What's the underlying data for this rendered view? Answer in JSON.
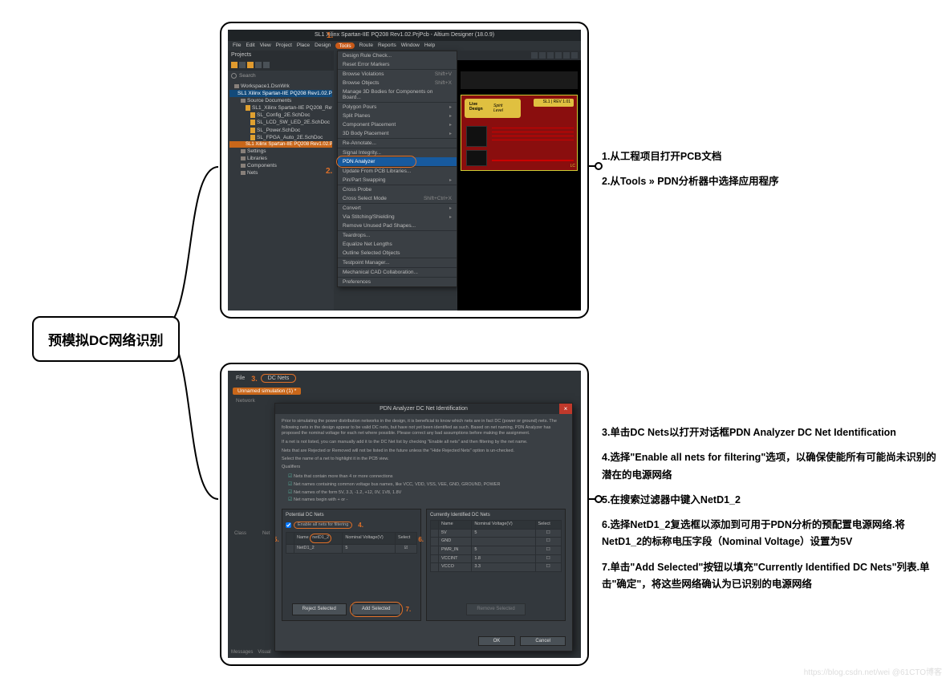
{
  "title_box": "预模拟DC网络识别",
  "top_annotations": [
    "1.从工程项目打开PCB文档",
    "2.从Tools » PDN分析器中选择应用程序"
  ],
  "bottom_annotations": [
    "3.单击DC Nets以打开对话框PDN Analyzer DC Net Identification",
    "4.选择\"Enable all nets for filtering\"选项，以确保使能所有可能尚未识别的潜在的电源网络",
    "5.在搜索过滤器中键入NetD1_2",
    "6.选择NetD1_2复选框以添加到可用于PDN分析的预配置电源网络.将NetD1_2的标称电压字段（Nominal Voltage）设置为5V",
    "7.单击\"Add Selected\"按钮以填充\"Currently Identified DC Nets\"列表.单击\"确定\"，将这些网络确认为已识别的电源网络"
  ],
  "altium": {
    "app_title": "SL1 Xilinx Spartan-IIE PQ208 Rev1.02.PrjPcb - Altium Designer (18.0.9)",
    "menus": [
      "File",
      "Edit",
      "View",
      "Project",
      "Place",
      "Design",
      "Tools",
      "Route",
      "Reports",
      "Window",
      "Help"
    ],
    "projects_label": "Projects",
    "search_label": "Search",
    "tree": {
      "workspace": "Workspace1.DsnWrk",
      "project": "SL1 Xilinx Spartan-IIE PQ208 Rev1.02.PrjPcb",
      "source_docs": "Source Documents",
      "files": [
        "SL1_Xilinx Spartan-IIE PQ208_Rev1.02.S",
        "SL_Config_2E.SchDoc",
        "SL_LCD_SW_LED_2E.SchDoc",
        "SL_Power.SchDoc",
        "SL_FPGA_Auto_2E.SchDoc"
      ],
      "active_file": "SL1 Xilinx Spartan-IIE PQ208 Rev1.02.P",
      "folders": [
        "Settings",
        "Libraries",
        "Components",
        "Nets"
      ]
    },
    "tools_menu": [
      {
        "label": "Design Rule Check...",
        "sep": false
      },
      {
        "label": "Reset Error Markers",
        "sep": true
      },
      {
        "label": "Browse Violations",
        "shortcut": "Shift+V"
      },
      {
        "label": "Browse Objects",
        "shortcut": "Shift+X"
      },
      {
        "label": "Manage 3D Bodies for Components on Board...",
        "sep": true
      },
      {
        "label": "Polygon Pours",
        "sub": true
      },
      {
        "label": "Split Planes",
        "sub": true
      },
      {
        "label": "Component Placement",
        "sub": true
      },
      {
        "label": "3D Body Placement",
        "sub": true,
        "sep": true
      },
      {
        "label": "Re-Annotate...",
        "sep": true
      },
      {
        "label": "Signal Integrity...",
        "sep": false
      },
      {
        "label": "PDN Analyzer",
        "hl": true,
        "sep": true
      },
      {
        "label": "Update From PCB Libraries...",
        "sep": false
      },
      {
        "label": "Pin/Part Swapping",
        "sub": true,
        "sep": true
      },
      {
        "label": "Cross Probe",
        "sep": false
      },
      {
        "label": "Cross Select Mode",
        "shortcut": "Shift+Ctrl+X",
        "sep": true
      },
      {
        "label": "Convert",
        "sub": true
      },
      {
        "label": "Via Stitching/Shielding",
        "sub": true
      },
      {
        "label": "Remove Unused Pad Shapes...",
        "sep": true
      },
      {
        "label": "Teardrops...",
        "sep": false
      },
      {
        "label": "Equalize Net Lengths",
        "sep": false
      },
      {
        "label": "Outline Selected Objects",
        "sep": true
      },
      {
        "label": "Testpoint Manager...",
        "sep": true
      },
      {
        "label": "Mechanical CAD Collaboration...",
        "sep": true
      },
      {
        "label": "Preferences",
        "sep": false
      }
    ],
    "step_labels": {
      "s1": "1.",
      "s2": "2."
    }
  },
  "pdn": {
    "tabs": {
      "file": "File",
      "num3": "3.",
      "dcnets": "DC Nets"
    },
    "sim_tab": "Unnamed simulation (1) *",
    "network_label": "Network",
    "cols": {
      "class": "Class",
      "net": "Net"
    },
    "bottom_tabs": [
      "Messages",
      "Visual"
    ],
    "dialog": {
      "title": "PDN Analyzer DC Net Identification",
      "intro1": "Prior to simulating the power distribution networks in the design, it is beneficial to know which nets are in fact DC (power or ground) nets. The following nets in the design appear to be valid DC nets, but have not yet been identified as such. Based on net naming, PDN Analyzer has proposed the nominal voltage for each net where possible. Please correct any bad assumptions before making the assignment.",
      "intro2": "If a net is not listed, you can manually add it to the DC Net list by checking \"Enable all nets\" and then filtering by the net name.",
      "intro3": "Nets that are Rejected or Removed will not be listed in the future unless the \"Hide Rejected Nets\" option is un-checked.",
      "select_hint": "Select the name of a net to highlight it in the PCB view.",
      "qualifiers_label": "Qualifiers",
      "qualifiers": [
        "Nets that contain more than 4 or more connections",
        "Net names containing common voltage bus names, like VCC, VDD, VSS, VEE, GND, GROUND, POWER",
        "Net names of the form 5V, 3.3, -1.2, +12, 0V, 1V8, 1.8V",
        "Net names begin with + or -"
      ],
      "potential_label": "Potential DC Nets",
      "enable_all": "Enable all nets for filtering",
      "name_label": "Name",
      "filter_value": "netD1_2",
      "nominal_v_label": "Nominal Voltage(V)",
      "select_col": "Select",
      "potential_rows": [
        {
          "name": "NetD1_2",
          "v": "5",
          "sel": true
        }
      ],
      "current_label": "Currently Identified DC Nets",
      "current_headers": {
        "name": "Name",
        "v": "Nominal Voltage(V)",
        "sel": "Select"
      },
      "current_rows": [
        {
          "name": "5V",
          "v": "5"
        },
        {
          "name": "GND",
          "v": ""
        },
        {
          "name": "PWR_IN",
          "v": "5"
        },
        {
          "name": "VCCINT",
          "v": "1.8"
        },
        {
          "name": "VCCO",
          "v": "3.3"
        }
      ],
      "reject_btn": "Reject Selected",
      "add_btn": "Add Selected",
      "remove_btn": "Remove Selected",
      "ok_btn": "OK",
      "cancel_btn": "Cancel"
    },
    "step_labels": {
      "s4": "4.",
      "s5": "5.",
      "s6": "6.",
      "s7": "7."
    }
  },
  "watermark": "https://blog.csdn.net/wei @61CTO博客"
}
